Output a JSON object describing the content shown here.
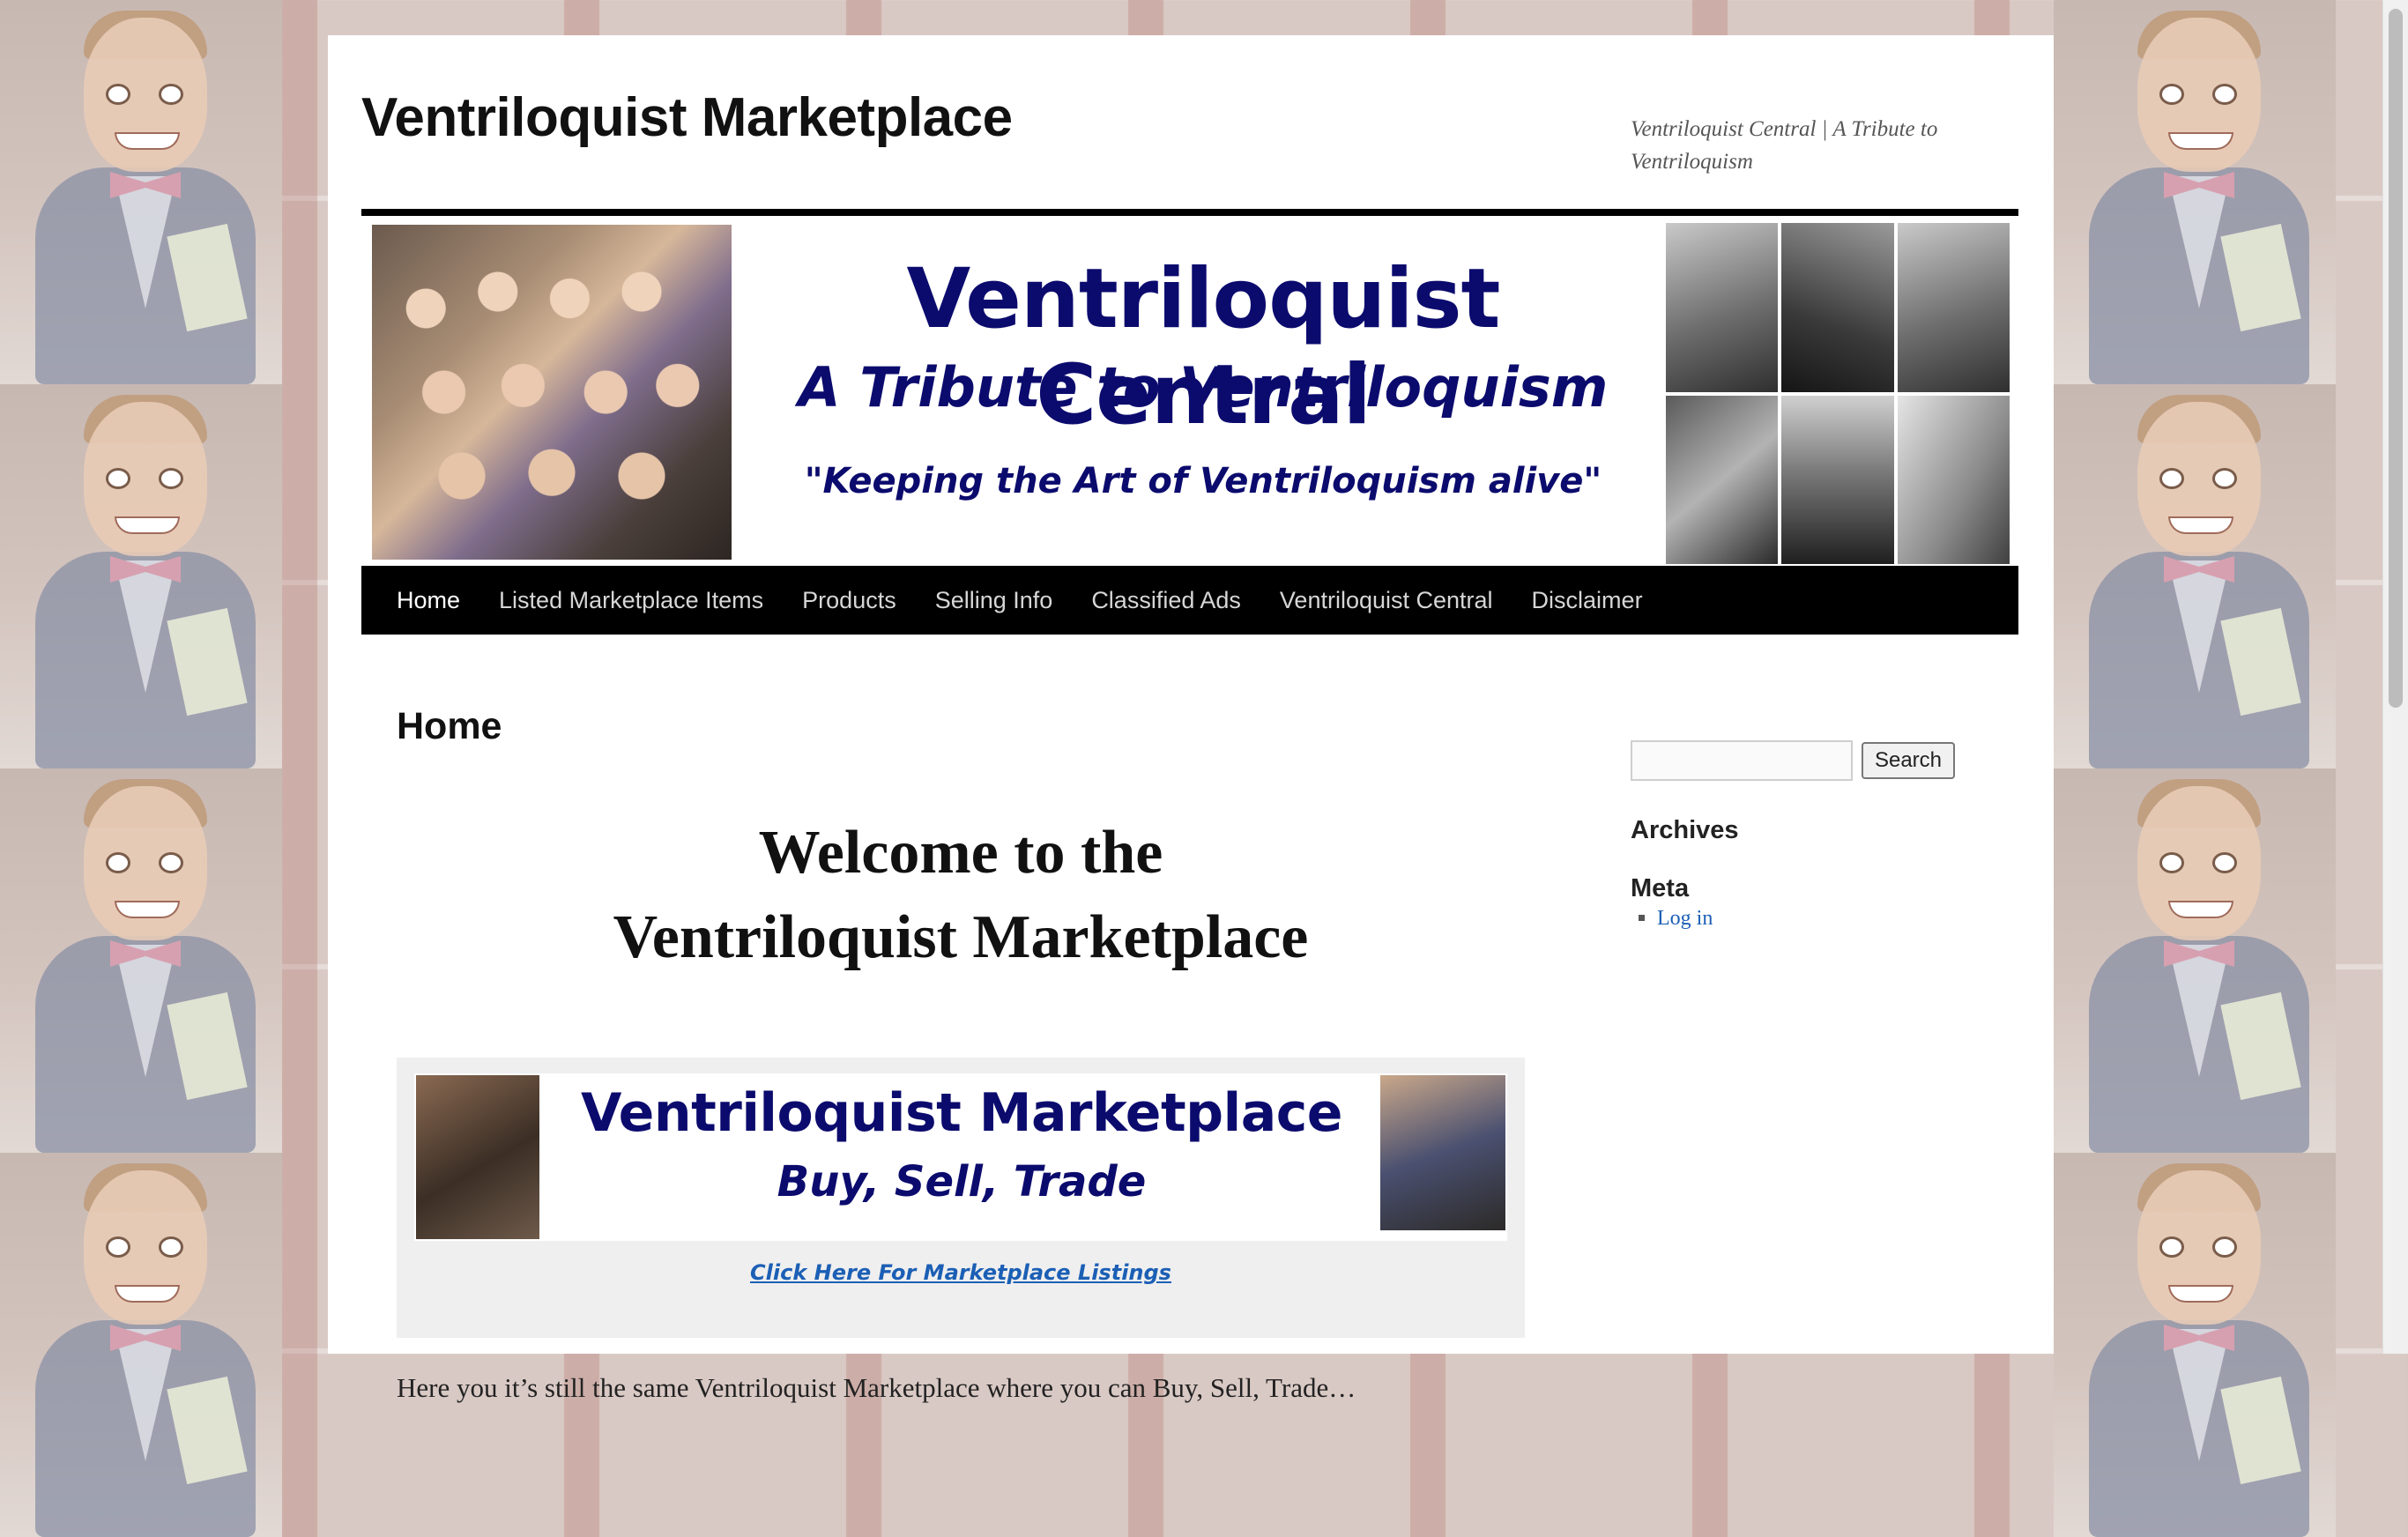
{
  "site": {
    "title": "Ventriloquist Marketplace",
    "tagline": "Ventriloquist Central | A Tribute to Ventriloquism"
  },
  "banner": {
    "heading": "Ventriloquist Central",
    "subheading": "A Tribute to Ventriloquism",
    "quote": "\"Keeping the Art of Ventriloquism alive\""
  },
  "nav": {
    "items": [
      {
        "label": "Home",
        "current": true
      },
      {
        "label": "Listed Marketplace Items"
      },
      {
        "label": "Products"
      },
      {
        "label": "Selling Info"
      },
      {
        "label": "Classified Ads"
      },
      {
        "label": "Ventriloquist Central"
      },
      {
        "label": "Disclaimer"
      }
    ]
  },
  "main": {
    "page_title": "Home",
    "welcome_line1": "Welcome to the",
    "welcome_line2": "Ventriloquist Marketplace",
    "market_banner": {
      "title": "Ventriloquist Marketplace",
      "subtitle": "Buy, Sell, Trade"
    },
    "listings_link": "Click Here For Marketplace Listings",
    "body_text": "Here you it’s still the same Ventriloquist Marketplace where you can Buy, Sell, Trade…"
  },
  "sidebar": {
    "search_button": "Search",
    "archives_title": "Archives",
    "meta_title": "Meta",
    "meta_links": [
      "Log in"
    ]
  },
  "colors": {
    "banner_text": "#0b0b6e",
    "nav_bg": "#000000",
    "link": "#1b5fb5"
  }
}
